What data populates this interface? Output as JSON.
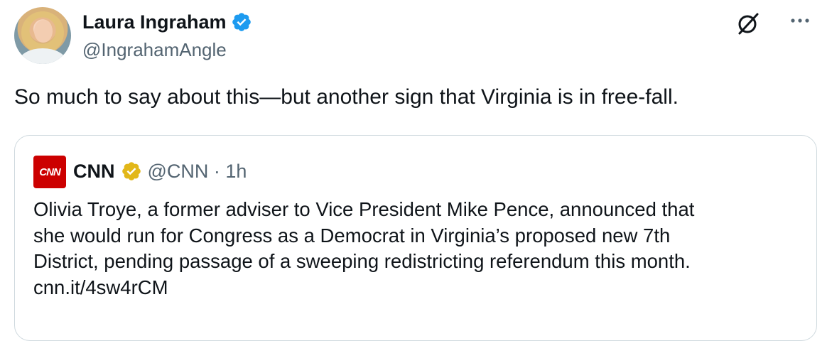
{
  "author": {
    "name": "Laura Ingraham",
    "handle": "@IngrahamAngle",
    "verified_color": "#1d9bf0"
  },
  "header_icons": [
    "grok-icon",
    "more-icon"
  ],
  "tweet": {
    "text": "So much to say about this—but another sign that Virginia is in free-fall."
  },
  "quote": {
    "logo_text": "CNN",
    "name": "CNN",
    "handle_time": "@CNN · 1h",
    "badge_color": "#e2b719",
    "lines": [
      "Olivia Troye, a former adviser to Vice President Mike Pence, announced that",
      "she would run for Congress as a Democrat in Virginia’s proposed new 7th",
      "District, pending passage of a sweeping redistricting referendum this month.",
      "cnn.it/4sw4rCM"
    ]
  },
  "colors": {
    "text": "#0f1419",
    "secondary": "#536471",
    "border": "#cfd9de",
    "cnn_red": "#cc0000"
  }
}
